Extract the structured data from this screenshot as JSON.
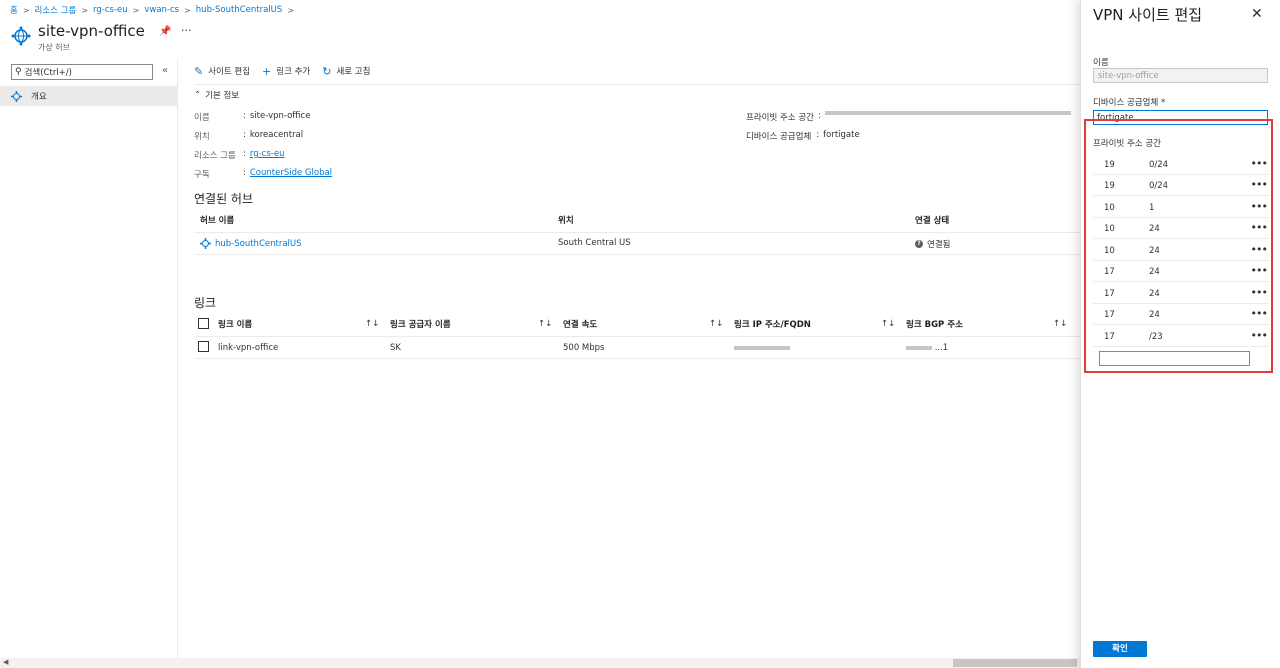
{
  "breadcrumb": [
    "홈",
    "리소스 그룹",
    "rg-cs-eu",
    "vwan-cs",
    "hub-SouthCentralUS"
  ],
  "header": {
    "title": "site-vpn-office",
    "subtitle": "가상 허브"
  },
  "nav": {
    "search_placeholder": "검색(Ctrl+/)",
    "items": [
      {
        "label": "개요"
      }
    ]
  },
  "toolbar": {
    "edit_label": "사이트 편집",
    "add_link_label": "링크 추가",
    "refresh_label": "새로 고침"
  },
  "essentials": {
    "toggle_label": "기본 정보",
    "left": [
      {
        "label": "이름",
        "value": "site-vpn-office"
      },
      {
        "label": "위치",
        "value": "koreacentral"
      },
      {
        "label": "리소스 그룹",
        "value": "rg-cs-eu"
      },
      {
        "label": "구독",
        "value": "CounterSide Global"
      }
    ],
    "right": [
      {
        "label": "프라이빗 주소 공간",
        "value": ""
      },
      {
        "label": "디바이스 공급업체",
        "value": "fortigate"
      }
    ]
  },
  "hubs": {
    "title": "연결된 허브",
    "columns": [
      "허브 이름",
      "위치",
      "연결 상태"
    ],
    "rows": [
      {
        "name": "hub-SouthCentralUS",
        "location": "South Central US",
        "status": "연결됨"
      }
    ]
  },
  "links": {
    "title": "링크",
    "columns": [
      "링크 이름",
      "링크 공급자 이름",
      "연결 속도",
      "링크 IP 주소/FQDN",
      "링크 BGP 주소"
    ],
    "rows": [
      {
        "name": "link-vpn-office",
        "provider": "SK",
        "speed": "500 Mbps",
        "ip": "",
        "bgp": "...1"
      }
    ]
  },
  "panel": {
    "title": "VPN 사이트 편집",
    "name_label": "이름",
    "name_value": "site-vpn-office",
    "vendor_label": "디바이스 공급업체 *",
    "vendor_value": "fortigate",
    "space_label": "프라이빗 주소 공간",
    "addresses": [
      {
        "a": "19",
        "b": "0/24"
      },
      {
        "a": "19",
        "b": "0/24"
      },
      {
        "a": "10",
        "b": "1"
      },
      {
        "a": "10",
        "b": "24"
      },
      {
        "a": "10",
        "b": "24"
      },
      {
        "a": "17",
        "b": "24"
      },
      {
        "a": "17",
        "b": "24"
      },
      {
        "a": "17",
        "b": "24"
      },
      {
        "a": "17",
        "b": "/23"
      }
    ],
    "ok_label": "확인"
  },
  "colors": {
    "accent": "#0078d4",
    "highlight": "#e03c3c"
  }
}
